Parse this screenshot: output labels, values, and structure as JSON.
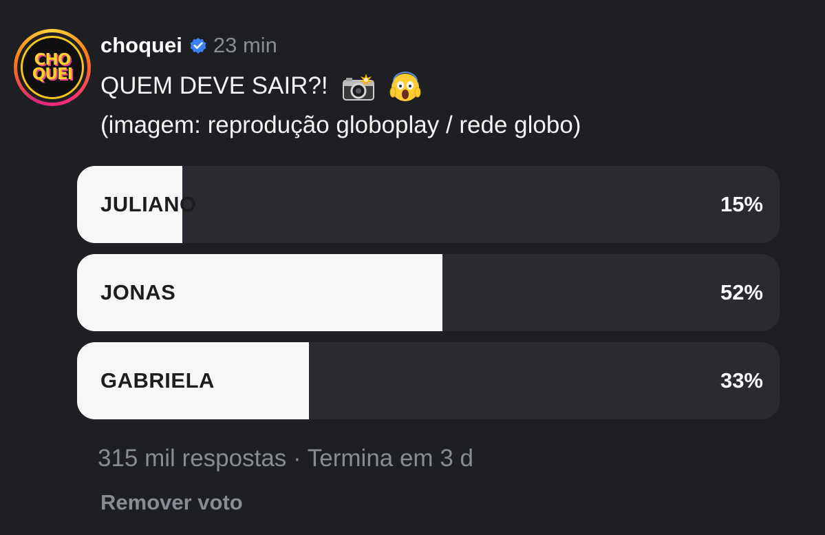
{
  "post": {
    "username": "choquei",
    "time": "23 min",
    "avatar_text": [
      "CHO",
      "QUEI"
    ],
    "caption_line1": "QUEM DEVE SAIR?!",
    "caption_emojis": [
      "camera-flash-icon",
      "screaming-face-icon"
    ],
    "caption_line2": "(imagem: reprodução globoplay / rede globo)"
  },
  "poll": {
    "options": [
      {
        "label": "JULIANO",
        "percent_text": "15%",
        "percent": 15
      },
      {
        "label": "JONAS",
        "percent_text": "52%",
        "percent": 52
      },
      {
        "label": "GABRIELA",
        "percent_text": "33%",
        "percent": 33
      }
    ],
    "footer": "315 mil respostas · Termina em 3 d",
    "remove_vote": "Remover voto"
  },
  "colors": {
    "background": "#1e1f23",
    "poll_track": "#2a2b31",
    "poll_fill": "#f7f7f7",
    "muted_text": "#8a8c93",
    "verified_blue": "#3b82f6"
  }
}
